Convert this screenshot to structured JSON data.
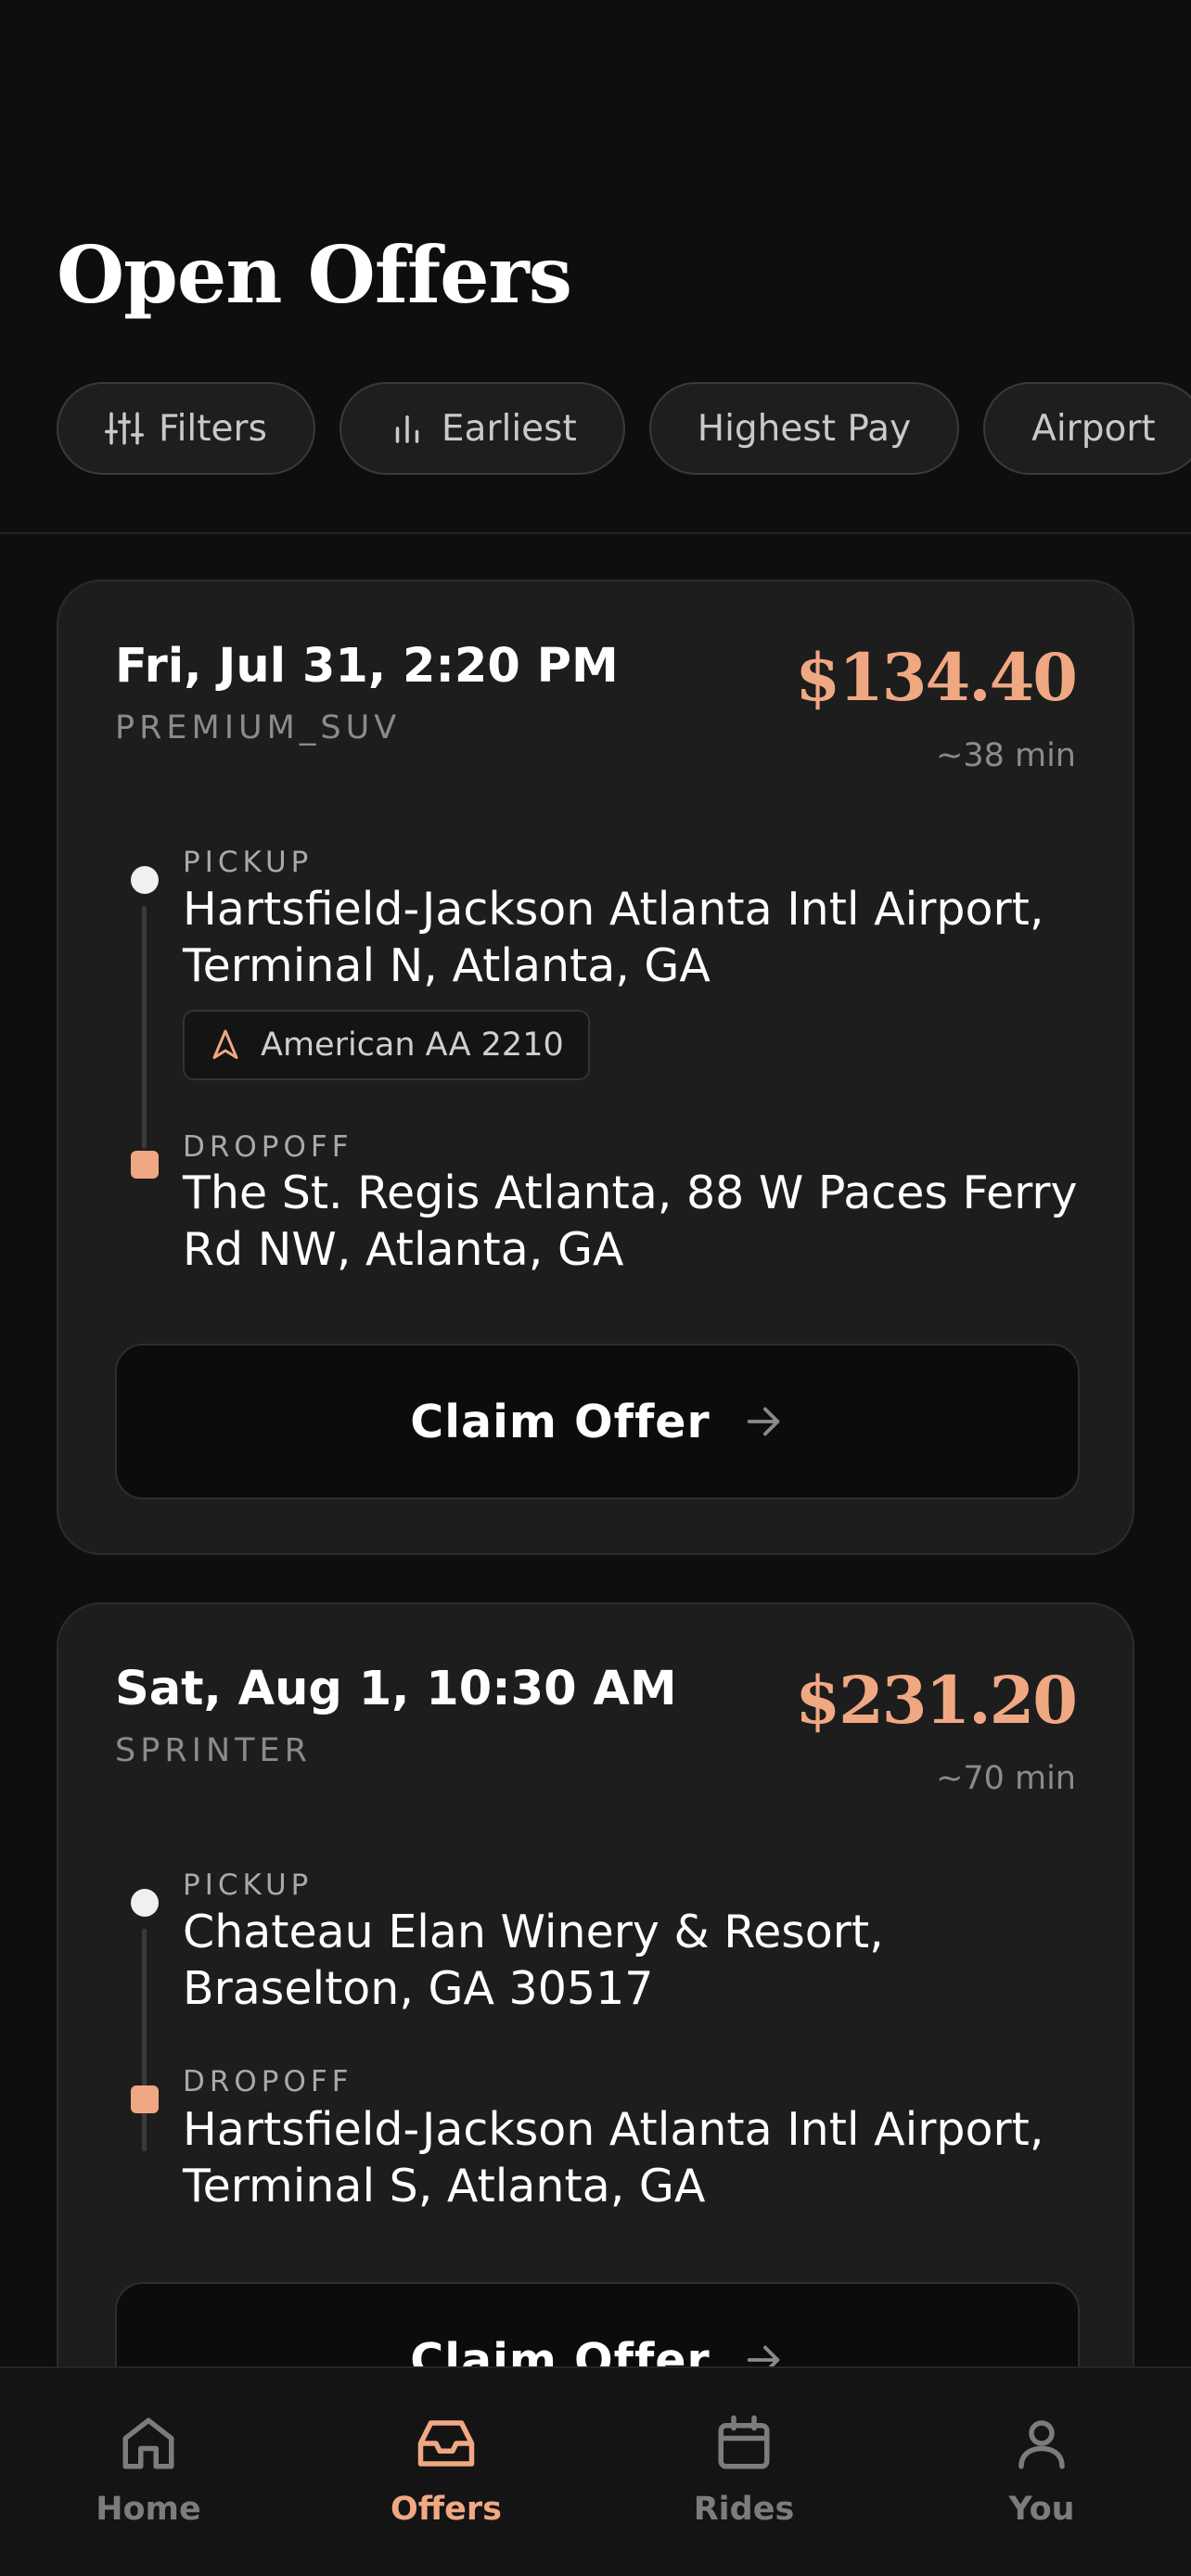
{
  "page": {
    "title": "Open Offers"
  },
  "filters": [
    {
      "label": "Filters",
      "icon": "sliders-icon"
    },
    {
      "label": "Earliest",
      "icon": "bars-icon"
    },
    {
      "label": "Highest Pay"
    },
    {
      "label": "Airport"
    }
  ],
  "offers": [
    {
      "datetime": "Fri, Jul 31, 2:20 PM",
      "vehicle_class": "PREMIUM_SUV",
      "price": "$134.40",
      "duration": "~38 min",
      "pickup_label": "PICKUP",
      "pickup": "Hartsfield-Jackson Atlanta Intl Airport, Terminal N, Atlanta, GA",
      "flight": "American AA 2210",
      "dropoff_label": "DROPOFF",
      "dropoff": "The St. Regis Atlanta, 88 W Paces Ferry Rd NW, Atlanta, GA",
      "claim_label": "Claim Offer"
    },
    {
      "datetime": "Sat, Aug 1, 10:30 AM",
      "vehicle_class": "SPRINTER",
      "price": "$231.20",
      "duration": "~70 min",
      "pickup_label": "PICKUP",
      "pickup": "Chateau Elan Winery & Resort, Braselton, GA 30517",
      "dropoff_label": "DROPOFF",
      "dropoff": "Hartsfield-Jackson Atlanta Intl Airport, Terminal S, Atlanta, GA",
      "claim_label": "Claim Offer"
    }
  ],
  "tabbar": [
    {
      "label": "Home",
      "icon": "home-icon",
      "active": false
    },
    {
      "label": "Offers",
      "icon": "inbox-icon",
      "active": true
    },
    {
      "label": "Rides",
      "icon": "calendar-icon",
      "active": false
    },
    {
      "label": "You",
      "icon": "user-icon",
      "active": false
    }
  ],
  "colors": {
    "accent": "#f0a883",
    "background": "#0e0e0e",
    "card": "#1d1d1d"
  }
}
